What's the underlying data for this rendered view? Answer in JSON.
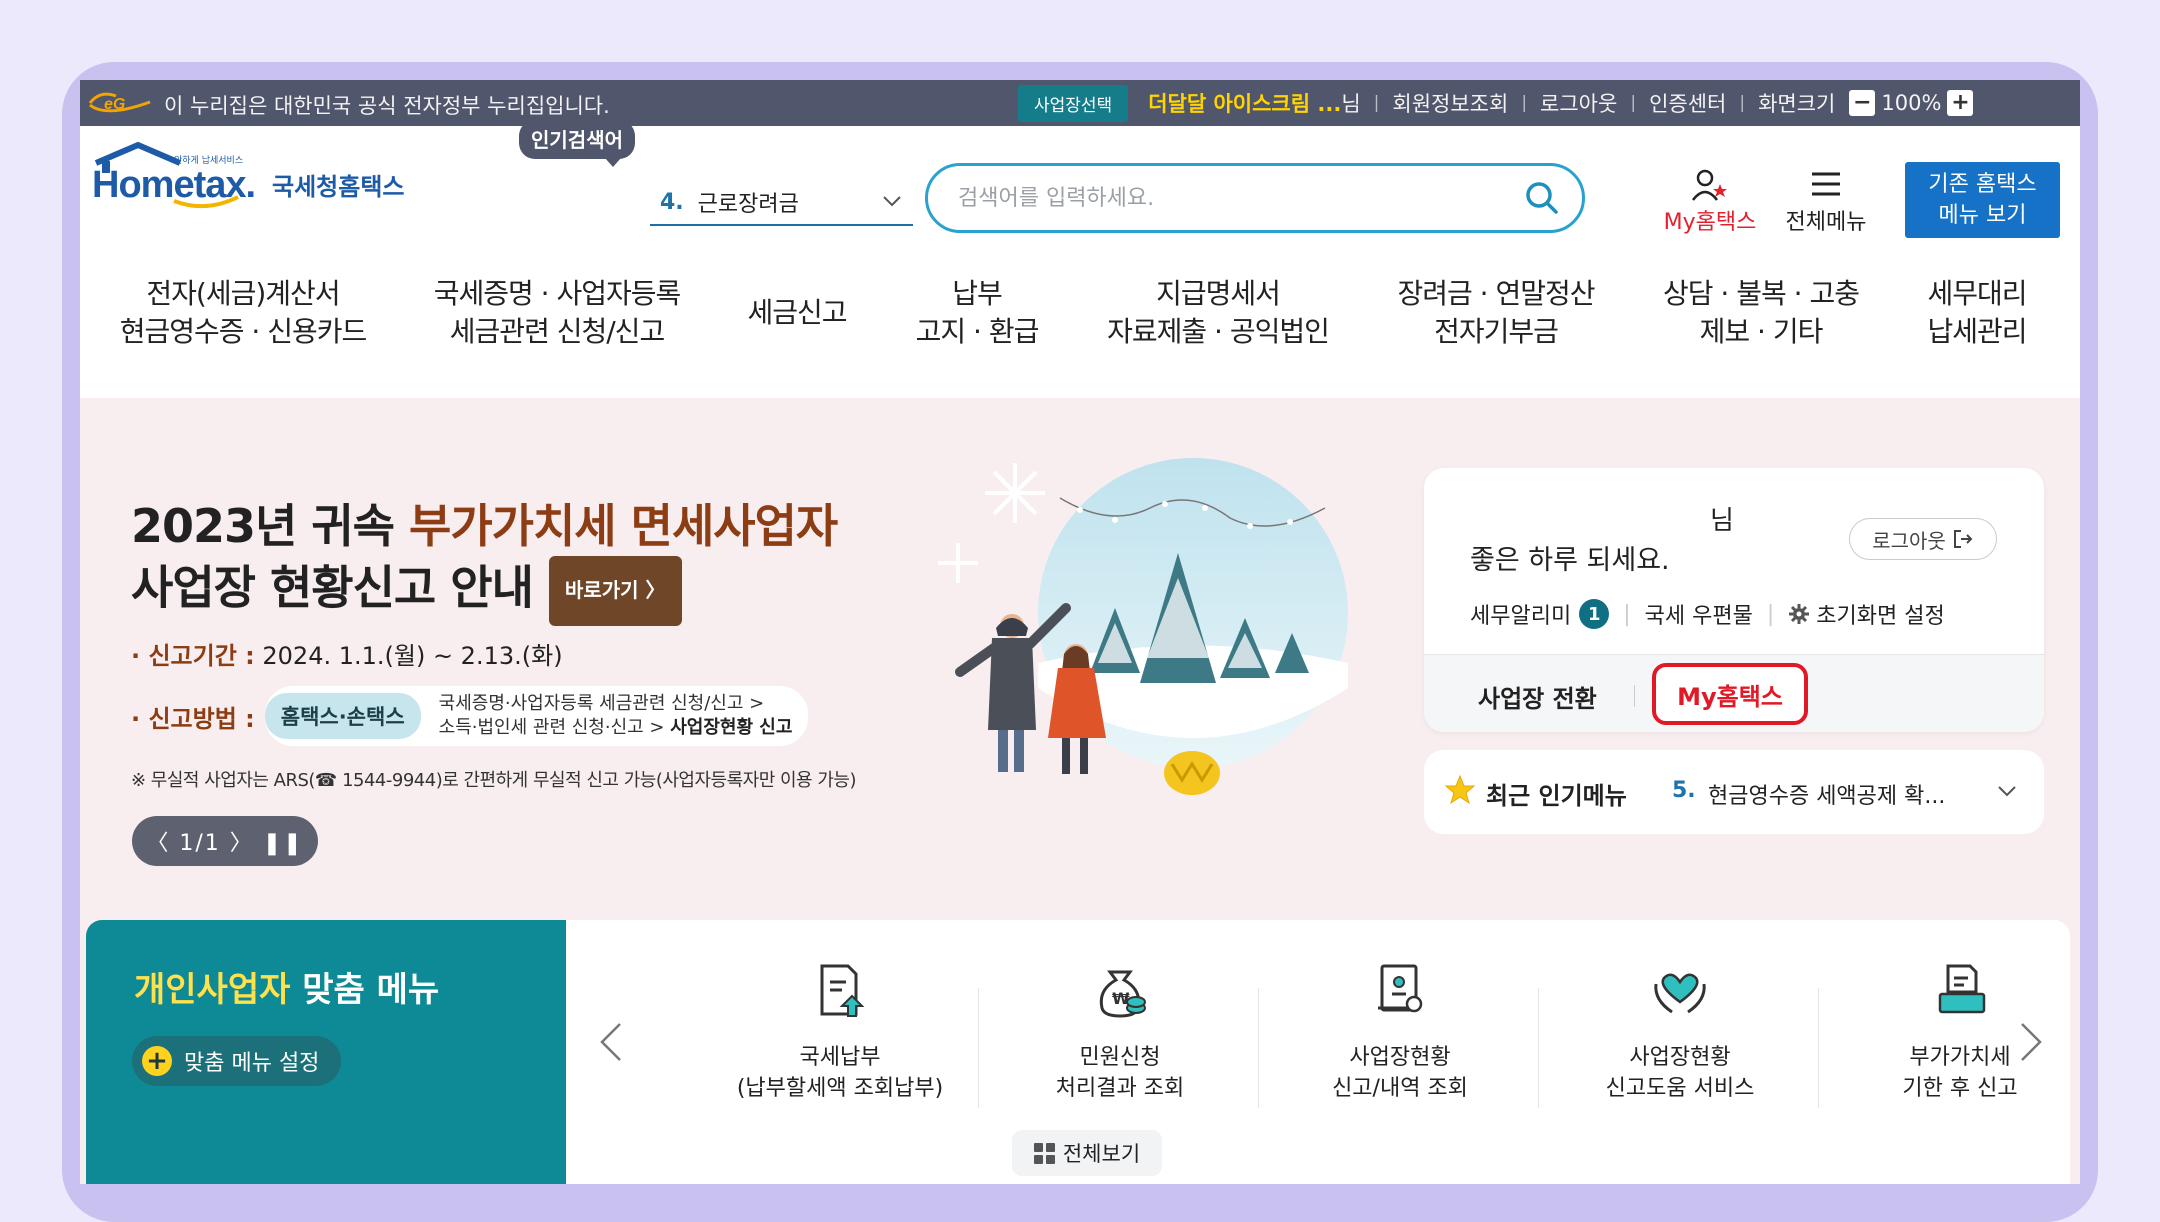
{
  "gov_banner": {
    "text": "이 누리집은 대한민국 공식 전자정부 누리집입니다.",
    "site_select": "사업장선택",
    "company": "더달달 아이스크림 ...",
    "honorific": "님",
    "links": [
      "회원정보조회",
      "로그아웃",
      "인증센터"
    ],
    "zoom_label": "화면크기",
    "zoom_value": "100%",
    "zoom_out": "−",
    "zoom_in": "+"
  },
  "header": {
    "logo_small": "안하게 납세서비스",
    "logo_main": "Hometax.",
    "logo_sub": "국세청홈택스",
    "popular_badge": "인기검색어",
    "popular_num": "4.",
    "popular_term": "근로장려금",
    "search_placeholder": "검색어를 입력하세요.",
    "my_hometax": "My홈택스",
    "all_menu": "전체메뉴",
    "legacy_line1": "기존 홈택스",
    "legacy_line2": "메뉴 보기"
  },
  "gnb": [
    {
      "line1": "전자(세금)계산서",
      "line2": "현금영수증 · 신용카드"
    },
    {
      "line1": "국세증명 · 사업자등록",
      "line2": "세금관련 신청/신고"
    },
    {
      "line1": "세금신고",
      "line2": ""
    },
    {
      "line1": "납부",
      "line2": "고지 · 환급"
    },
    {
      "line1": "지급명세서",
      "line2": "자료제출 · 공익법인"
    },
    {
      "line1": "장려금 · 연말정산",
      "line2": "전자기부금"
    },
    {
      "line1": "상담 · 불복 · 고충",
      "line2": "제보 · 기타"
    },
    {
      "line1": "세무대리",
      "line2": "납세관리"
    }
  ],
  "hero": {
    "title_l1_a": "2023년 귀속 ",
    "title_l1_b": "부가가치세 면세사업자",
    "title_l2": "사업장 현황신고 안내",
    "goto": "바로가기 〉",
    "period_label": "· 신고기간 :",
    "period_value": " 2024. 1.1.(월) ~ 2.13.(화)",
    "method_label": "· 신고방법 :",
    "method_tag": "홈택스·손택스",
    "method_line1": "국세증명·사업자등록 세금관련 신청/신고 >",
    "method_line2a": "소득·법인세 관련 신청·신고 > ",
    "method_line2b": "사업장현황 신고",
    "note": "※ 무실적 사업자는 ARS(☎ 1544-9944)로 간편하게 무실적 신고 가능(사업자등록자만 이용 가능)",
    "pager": "〈 1/1 〉 ❚❚"
  },
  "user_panel": {
    "name_suffix": "님",
    "greeting": "좋은 하루 되세요.",
    "logout": "로그아웃",
    "notifier": "세무알리미",
    "notifier_count": "1",
    "mailbox": "국세 우편물",
    "home_setting": "초기화면 설정",
    "switch_biz": "사업장 전환",
    "my_hometax": "My홈택스"
  },
  "recent": {
    "label": "최근 인기메뉴",
    "num": "5.",
    "item": "현금영수증 세액공제 확..."
  },
  "custom_menu": {
    "title_a": "개인사업자",
    "title_b": " 맞춤 메뉴",
    "setting": "맞춤 메뉴 설정",
    "items": [
      {
        "l1": "국세납부",
        "l2": "(납부할세액 조회납부)"
      },
      {
        "l1": "민원신청",
        "l2": "처리결과 조회"
      },
      {
        "l1": "사업장현황",
        "l2": "신고/내역 조회"
      },
      {
        "l1": "사업장현황",
        "l2": "신고도움 서비스"
      },
      {
        "l1": "부가가치세",
        "l2": "기한 후 신고"
      }
    ],
    "view_all": "전체보기"
  }
}
